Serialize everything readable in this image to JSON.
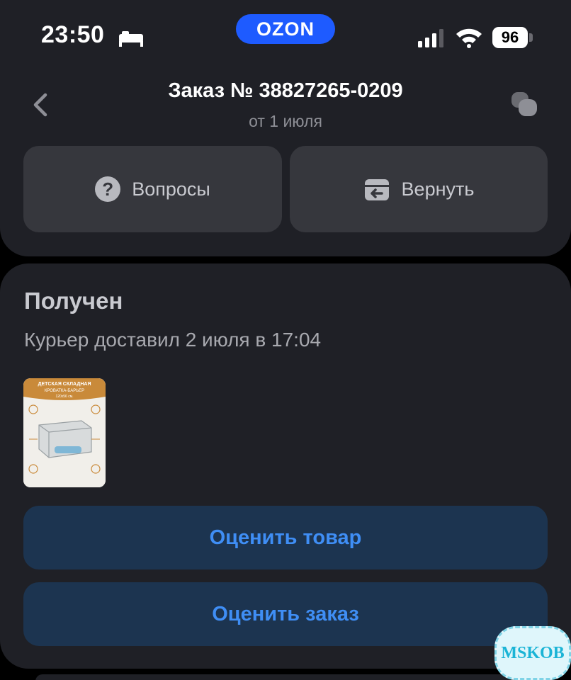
{
  "status_bar": {
    "time": "23:50",
    "brand": "OZON",
    "battery": "96",
    "icons": [
      "bed-icon",
      "signal-icon",
      "wifi-icon",
      "battery-icon"
    ]
  },
  "header": {
    "title": "Заказ № 38827265-0209",
    "subtitle": "от 1 июля",
    "icons": [
      "back-icon",
      "chat-icon"
    ]
  },
  "actions": {
    "questions_label": "Вопросы",
    "return_label": "Вернуть"
  },
  "order": {
    "status": "Получен",
    "description": "Курьер доставил 2 июля в 17:04",
    "product_image": {
      "line1": "ДЕТСКАЯ СКЛАДНАЯ",
      "line2": "КРОВАТКА-БАРЬЕР",
      "line3": "120x56 см."
    },
    "rate_product_label": "Оценить товар",
    "rate_order_label": "Оценить заказ"
  },
  "watermark": "MSKOB",
  "colors": {
    "background": "#000000",
    "card": "#1f2026",
    "button": "#36373d",
    "accent_button": "#1c3450",
    "accent_text": "#3f8ef5",
    "brand": "#1e5bff"
  }
}
